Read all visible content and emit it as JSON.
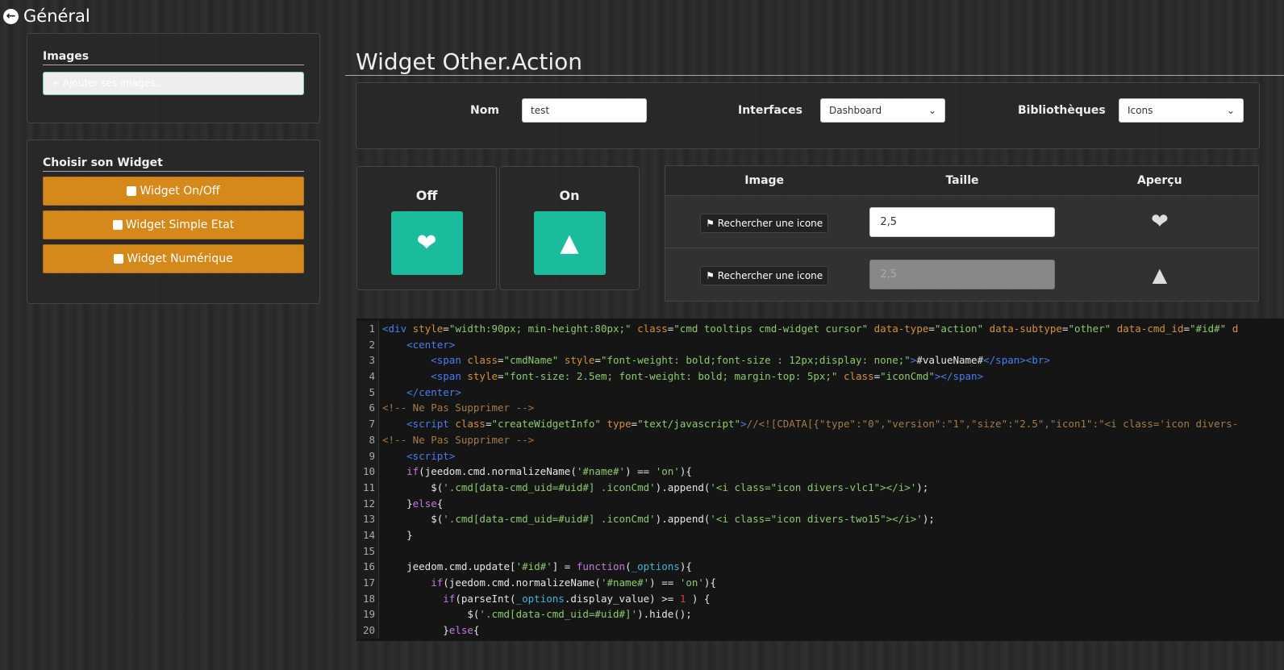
{
  "header": {
    "title": "Général",
    "back_icon": "arrow-circle-left-icon"
  },
  "images_panel": {
    "title": "Images",
    "upload_label": "Ajouter ses images..."
  },
  "widget_panel": {
    "title": "Choisir son Widget",
    "buttons": [
      "Widget On/Off",
      "Widget Simple Etat",
      "Widget Numérique"
    ]
  },
  "main": {
    "title": "Widget Other.Action",
    "form": {
      "nom_label": "Nom",
      "nom_value": "test",
      "interfaces_label": "Interfaces",
      "interfaces_value": "Dashboard",
      "bibliotheques_label": "Bibliothèques",
      "bibliotheques_value": "Icons"
    },
    "preview": {
      "off_label": "Off",
      "on_label": "On",
      "off_icon": "hearts-icon",
      "on_icon": "traffic-cone-icon",
      "accent": "#1abc9c"
    },
    "table": {
      "headers": [
        "Image",
        "Taille",
        "Aperçu"
      ],
      "rows": [
        {
          "button": "Rechercher une icone",
          "size": "2,5",
          "icon": "hearts-icon"
        },
        {
          "button": "Rechercher une icone",
          "size": "2,5",
          "icon": "traffic-cone-icon"
        }
      ]
    }
  },
  "code": [
    [
      [
        "t",
        "<div "
      ],
      [
        "a",
        "style"
      ],
      [
        "d",
        "="
      ],
      [
        "s",
        "\"width:90px; min-height:80px;\" "
      ],
      [
        "a",
        "class"
      ],
      [
        "d",
        "="
      ],
      [
        "s",
        "\"cmd tooltips cmd-widget cursor\" "
      ],
      [
        "a",
        "data-type"
      ],
      [
        "d",
        "="
      ],
      [
        "s",
        "\"action\" "
      ],
      [
        "a",
        "data-subtype"
      ],
      [
        "d",
        "="
      ],
      [
        "s",
        "\"other\" "
      ],
      [
        "a",
        "data-cmd_id"
      ],
      [
        "d",
        "="
      ],
      [
        "s",
        "\"#id#\" "
      ],
      [
        "a",
        "d"
      ]
    ],
    [
      [
        "d",
        "    "
      ],
      [
        "t",
        "<center>"
      ]
    ],
    [
      [
        "d",
        "        "
      ],
      [
        "t",
        "<span "
      ],
      [
        "a",
        "class"
      ],
      [
        "d",
        "="
      ],
      [
        "s",
        "\"cmdName\" "
      ],
      [
        "a",
        "style"
      ],
      [
        "d",
        "="
      ],
      [
        "s",
        "\"font-weight: bold;font-size : 12px;display: none;\""
      ],
      [
        "t",
        ">"
      ],
      [
        "d",
        "#valueName#"
      ],
      [
        "t",
        "</span><br>"
      ]
    ],
    [
      [
        "d",
        "        "
      ],
      [
        "t",
        "<span "
      ],
      [
        "a",
        "style"
      ],
      [
        "d",
        "="
      ],
      [
        "s",
        "\"font-size: 2.5em; font-weight: bold; margin-top: 5px;\" "
      ],
      [
        "a",
        "class"
      ],
      [
        "d",
        "="
      ],
      [
        "s",
        "\"iconCmd\""
      ],
      [
        "t",
        "></span>"
      ]
    ],
    [
      [
        "d",
        "    "
      ],
      [
        "t",
        "</center>"
      ]
    ],
    [
      [
        "c",
        "<!-- Ne Pas Supprimer -->"
      ]
    ],
    [
      [
        "d",
        "    "
      ],
      [
        "t",
        "<script "
      ],
      [
        "a",
        "class"
      ],
      [
        "d",
        "="
      ],
      [
        "s",
        "\"createWidgetInfo\" "
      ],
      [
        "a",
        "type"
      ],
      [
        "d",
        "="
      ],
      [
        "s",
        "\"text/javascript\""
      ],
      [
        "t",
        ">"
      ],
      [
        "c",
        "//<![CDATA[{\"type\":\"0\",\"version\":\"1\",\"size\":\"2.5\",\"icon1\":\"<i class='icon divers-"
      ]
    ],
    [
      [
        "c",
        "<!-- Ne Pas Supprimer -->"
      ]
    ],
    [
      [
        "d",
        "    "
      ],
      [
        "t",
        "<script>"
      ]
    ],
    [
      [
        "d",
        "    "
      ],
      [
        "k",
        "if"
      ],
      [
        "d",
        "(jeedom.cmd.normalizeName("
      ],
      [
        "s",
        "'#name#'"
      ],
      [
        "d",
        ") == "
      ],
      [
        "s",
        "'on'"
      ],
      [
        "d",
        "){"
      ]
    ],
    [
      [
        "d",
        "        $("
      ],
      [
        "s",
        "'.cmd[data-cmd_uid=#uid#] .iconCmd'"
      ],
      [
        "d",
        ").append("
      ],
      [
        "s",
        "'<i class=\"icon divers-vlc1\"></i>'"
      ],
      [
        "d",
        ");"
      ]
    ],
    [
      [
        "d",
        "    }"
      ],
      [
        "k",
        "else"
      ],
      [
        "d",
        "{"
      ]
    ],
    [
      [
        "d",
        "        $("
      ],
      [
        "s",
        "'.cmd[data-cmd_uid=#uid#] .iconCmd'"
      ],
      [
        "d",
        ").append("
      ],
      [
        "s",
        "'<i class=\"icon divers-two15\"></i>'"
      ],
      [
        "d",
        ");"
      ]
    ],
    [
      [
        "d",
        "    }"
      ]
    ],
    [],
    [
      [
        "d",
        "    jeedom.cmd.update["
      ],
      [
        "s",
        "'#id#'"
      ],
      [
        "d",
        "] = "
      ],
      [
        "k",
        "function"
      ],
      [
        "d",
        "("
      ],
      [
        "v",
        "_options"
      ],
      [
        "d",
        "){"
      ]
    ],
    [
      [
        "d",
        "        "
      ],
      [
        "k",
        "if"
      ],
      [
        "d",
        "(jeedom.cmd.normalizeName("
      ],
      [
        "s",
        "'#name#'"
      ],
      [
        "d",
        ") == "
      ],
      [
        "s",
        "'on'"
      ],
      [
        "d",
        "){"
      ]
    ],
    [
      [
        "d",
        "          "
      ],
      [
        "k",
        "if"
      ],
      [
        "d",
        "(parseInt("
      ],
      [
        "v",
        "_options"
      ],
      [
        "d",
        ".display_value) >= "
      ],
      [
        "n",
        "1"
      ],
      [
        "d",
        " ) {"
      ]
    ],
    [
      [
        "d",
        "              $("
      ],
      [
        "s",
        "'.cmd[data-cmd_uid=#uid#]'"
      ],
      [
        "d",
        ").hide();"
      ]
    ],
    [
      [
        "d",
        "          }"
      ],
      [
        "k",
        "else"
      ],
      [
        "d",
        "{"
      ]
    ]
  ]
}
